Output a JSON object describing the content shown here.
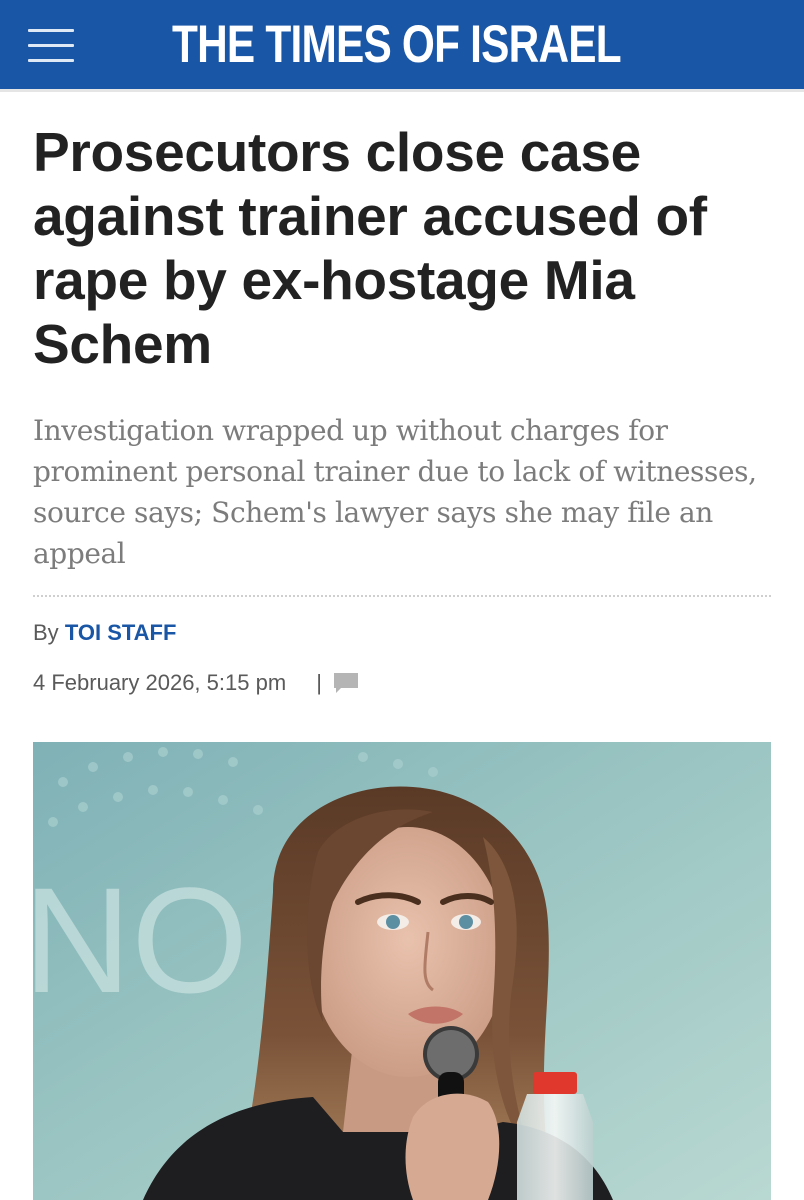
{
  "header": {
    "logo_text": "THE TIMES OF ISRAEL",
    "menu_icon": "hamburger-menu-icon",
    "background_color": "#1a56a6"
  },
  "article": {
    "headline": "Prosecutors close case against trainer accused of rape by ex-hostage Mia Schem",
    "subhead": "Investigation wrapped up without charges for prominent personal trainer due to lack of witnesses, source says; Schem's lawyer says she may file an appeal",
    "byline_prefix": "By",
    "author": "TOI STAFF",
    "date": "4 February 2026, 5:15 pm",
    "separator": "|",
    "comment_icon": "comment-bubble-icon",
    "author_color": "#1a56a6"
  },
  "image": {
    "background_text": "NO"
  }
}
